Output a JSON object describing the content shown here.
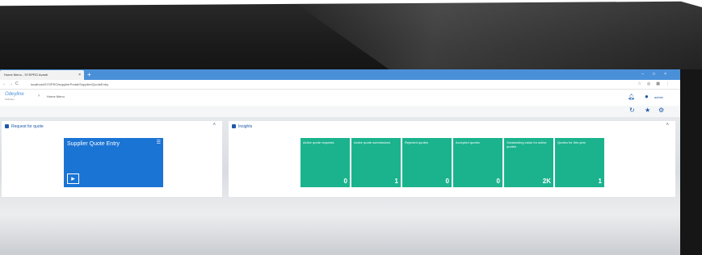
{
  "browser": {
    "tab_title": "Home Menu - SYSPRO Avanti",
    "tab_close": "×",
    "new_tab": "+",
    "window_controls": "–□×",
    "nav_buttons": "←→C",
    "url": "localhost/SYSPRO/supplierPortal/Supplier/QuoteEntry",
    "extensions": "☆◎▦⋮"
  },
  "app": {
    "logo_text": "Odeyline",
    "logo_sub": "Software",
    "breadcrumb_sep": "›",
    "breadcrumb": "Home Menu",
    "user_name": "admin",
    "icons": [
      "bell-icon",
      "user-icon",
      "refresh-icon",
      "star-icon",
      "gear-icon"
    ]
  },
  "panels": {
    "request": {
      "title": "Request for quote",
      "collapse": "˄",
      "tile": {
        "label": "Supplier Quote Entry",
        "menu": "☰"
      }
    },
    "insights": {
      "title": "Insights",
      "collapse": "˄",
      "tiles": [
        {
          "label": "Active quote requests",
          "value": "0"
        },
        {
          "label": "Active quote submissions",
          "value": "1"
        },
        {
          "label": "Rejected quotes",
          "value": "0"
        },
        {
          "label": "Accepted quotes",
          "value": "0"
        },
        {
          "label": "Outstanding value for active quotes",
          "value": "2K"
        },
        {
          "label": "Quotes for this year",
          "value": "1"
        }
      ]
    }
  },
  "colors": {
    "accent": "#1e5aa8",
    "tile_blue": "#1a74d4",
    "tile_teal": "#1bb38e",
    "tabbar": "#4a90d9"
  }
}
